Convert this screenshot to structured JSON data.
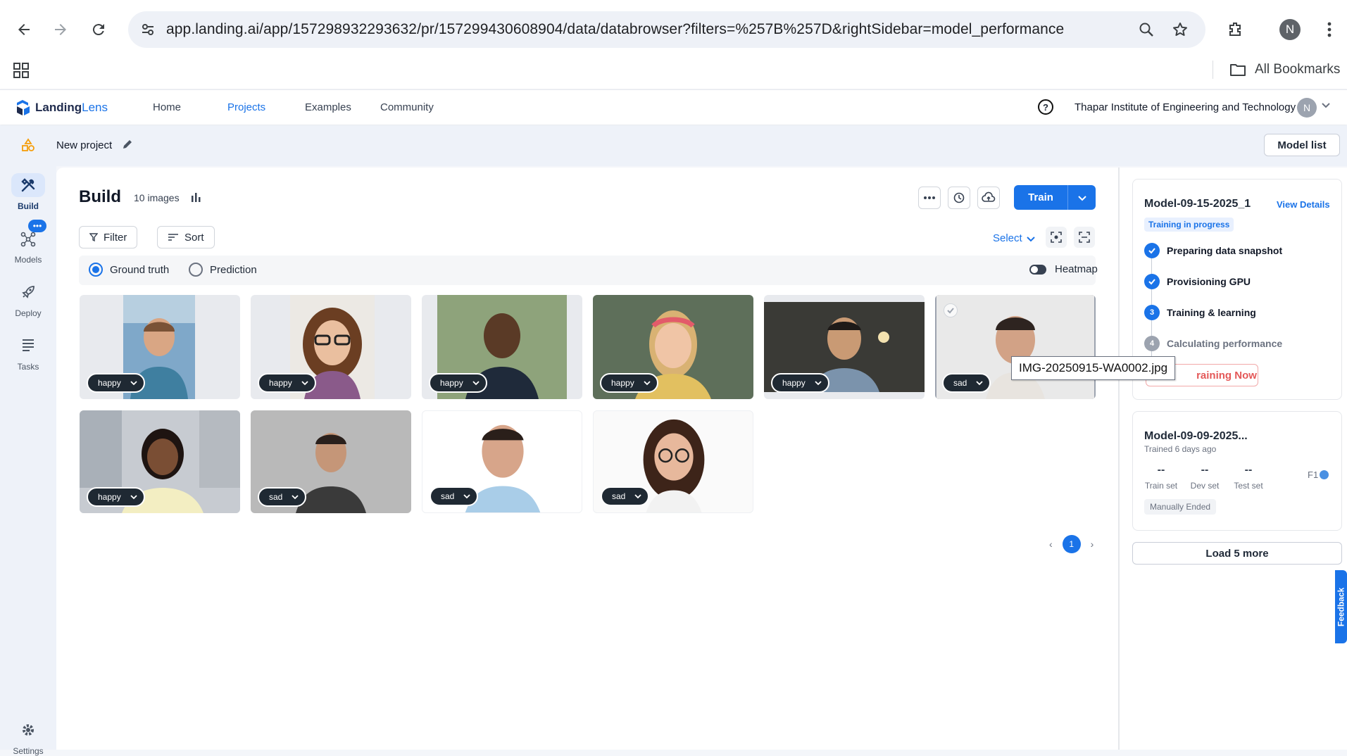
{
  "browser": {
    "url": "app.landing.ai/app/157298932293632/pr/157299430608904/data/databrowser?filters=%257B%257D&rightSidebar=model_performance",
    "profile_initial": "N",
    "bookmarks_label": "All Bookmarks"
  },
  "header": {
    "logo_text_a": "Landing",
    "logo_text_b": "Lens",
    "nav": [
      "Home",
      "Projects",
      "Examples",
      "Community"
    ],
    "active_nav": "Projects",
    "help": "?",
    "org_name": "Thapar Institute of Engineering and Technology",
    "user_initial": "N"
  },
  "project": {
    "name": "New project",
    "model_list_label": "Model list"
  },
  "rail": {
    "items": [
      "Build",
      "Models",
      "Deploy",
      "Tasks"
    ],
    "models_badge": "•••",
    "settings": "Settings"
  },
  "build": {
    "title": "Build",
    "image_count": "10 images",
    "train_label": "Train",
    "filter_label": "Filter",
    "sort_label": "Sort",
    "select_label": "Select",
    "ground_truth_label": "Ground truth",
    "prediction_label": "Prediction",
    "heatmap_label": "Heatmap",
    "tooltip": "IMG-20250915-WA0002.jpg",
    "page": "1",
    "images": [
      {
        "label": "happy"
      },
      {
        "label": "happy"
      },
      {
        "label": "happy"
      },
      {
        "label": "happy"
      },
      {
        "label": "happy"
      },
      {
        "label": "sad"
      },
      {
        "label": "happy"
      },
      {
        "label": "sad"
      },
      {
        "label": "sad"
      },
      {
        "label": "sad"
      }
    ]
  },
  "sidebar": {
    "model1": {
      "name": "Model-09-15-2025_1",
      "view_details": "View Details",
      "status": "Training in progress",
      "steps": [
        "Preparing data snapshot",
        "Provisioning GPU",
        "Training & learning",
        "Calculating performance"
      ],
      "step3_num": "3",
      "step4_num": "4",
      "stop_label": "Stop Training Now",
      "stop_visible": "raining Now"
    },
    "model2": {
      "name": "Model-09-09-2025...",
      "trained": "Trained 6 days ago",
      "train_set_value": "--",
      "dev_set_value": "--",
      "test_set_value": "--",
      "train_set_label": "Train set",
      "dev_set_label": "Dev set",
      "test_set_label": "Test set",
      "f1_label": "F1",
      "ended_label": "Manually Ended"
    },
    "load_more": "Load 5 more",
    "feedback": "Feedback"
  },
  "colors": {
    "accent": "#1a73e8",
    "danger": "#e45858",
    "rail_bg": "#eef2f9"
  }
}
